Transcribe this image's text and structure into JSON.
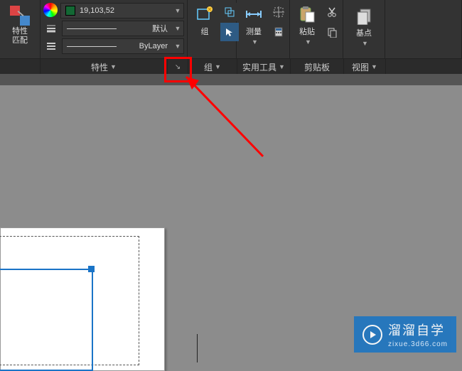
{
  "panels": {
    "match_properties": {
      "caption": "特性\n匹配"
    },
    "properties": {
      "color_swatch": "#136834",
      "color_value": "19,103,52",
      "lineweight_label": "默认",
      "linetype_label": "ByLayer",
      "header": "特性"
    },
    "group": {
      "caption": "组",
      "header": "组"
    },
    "measure": {
      "caption": "测量"
    },
    "utilities": {
      "header": "实用工具"
    },
    "paste": {
      "caption": "粘贴"
    },
    "clipboard": {
      "header": "剪贴板"
    },
    "basepoint": {
      "caption": "基点"
    },
    "view": {
      "header": "视图"
    }
  },
  "watermark": {
    "brand": "溜溜自学",
    "url": "zixue.3d66.com"
  }
}
